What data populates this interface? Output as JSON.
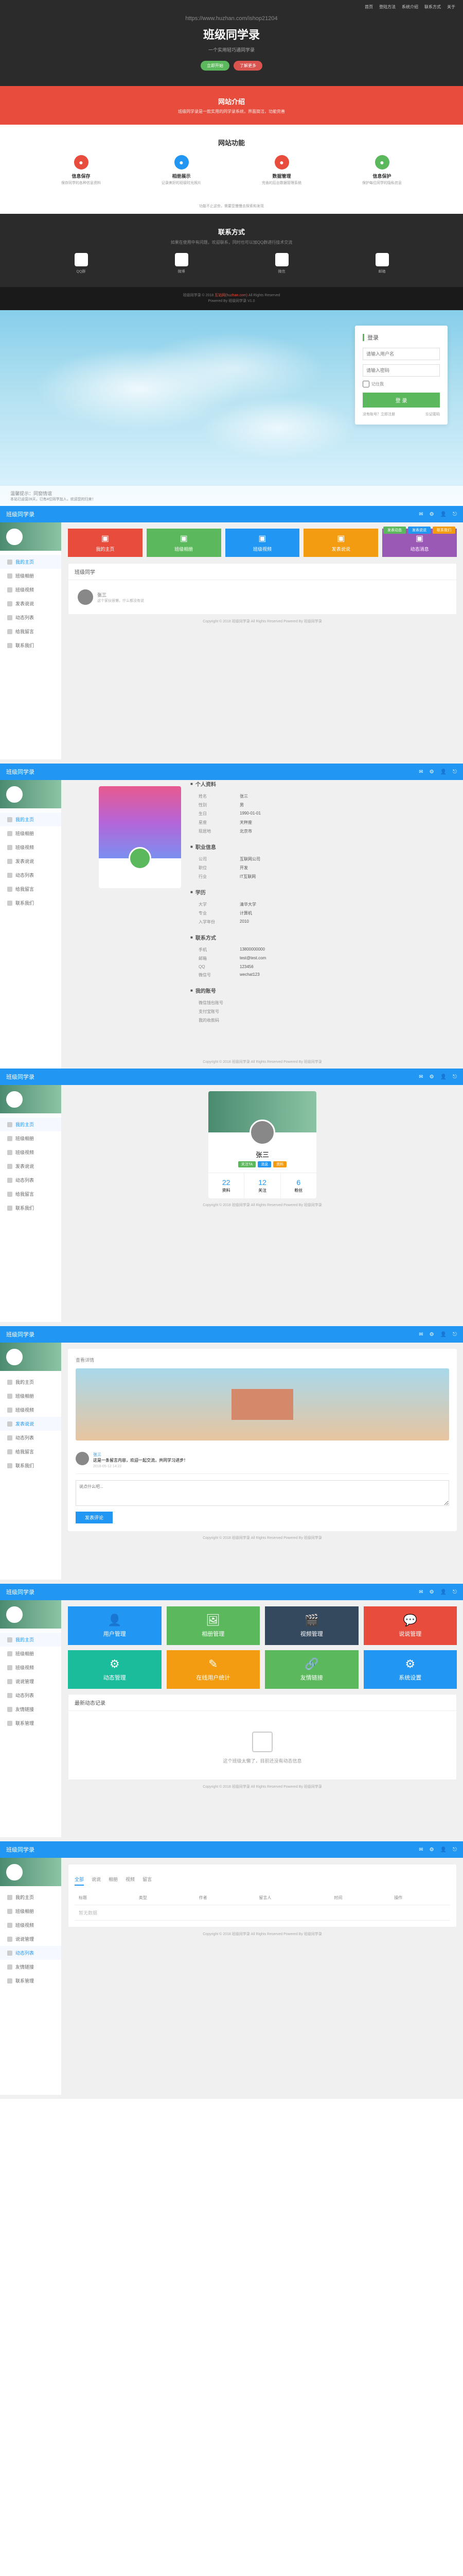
{
  "url": "https://www.huzhan.com/ishop21204",
  "landing": {
    "nav": [
      "首页",
      "登陆方法",
      "系统介绍",
      "联系方式",
      "关于"
    ],
    "title": "班级同学录",
    "subtitle": "一个实用轻巧通同学录",
    "btn1": "立即开始",
    "btn2": "了解更多",
    "intro_h": "网站介绍",
    "intro_p": "班级同学录是一款实用的同学录系统，界面简洁，功能完善",
    "func_h": "网站功能",
    "features": [
      {
        "title": "信息保存",
        "desc": "保存同学的各种信息资料",
        "color": "#e74c3c"
      },
      {
        "title": "相册展示",
        "desc": "记录美好的班级时光照片",
        "color": "#2196f3"
      },
      {
        "title": "数据管理",
        "desc": "完善的后台数据管理系统",
        "color": "#e74c3c"
      },
      {
        "title": "信息保护",
        "desc": "保护每位同学的隐私信息",
        "color": "#5cb85c"
      }
    ],
    "note": "功能不止这些，需要您慢慢去探索和发现",
    "contact_h": "联系方式",
    "contact_sub": "如果在使用中有问题，欢迎联系，同时也可以加QQ群进行技术交流",
    "contacts": [
      {
        "label": "QQ群"
      },
      {
        "label": "微博"
      },
      {
        "label": "微信"
      },
      {
        "label": "邮箱"
      }
    ],
    "footer1": "班级同学录 © 2018",
    "footer_red": "互站网(huzhan.com)",
    "footer2": "All Rights Reserved",
    "footer3": "Powered By 班级同学录 V1.0"
  },
  "login": {
    "header": "登录",
    "user_ph": "请输入用户名",
    "pass_ph": "请输入密码",
    "remember": "记住我",
    "btn": "登 录",
    "link1": "没有账号？立即注册",
    "link2": "忘记密码",
    "bottom": "温馨提示：同窗情谊",
    "bottom2": "本站已运营28天，已有4位同学加入，欢迎您的归来！"
  },
  "dash": {
    "brand": "班级同学录",
    "top_icons": [
      "✉",
      "⚙",
      "👤",
      "⎋"
    ],
    "menu": [
      "我的主页",
      "班级相册",
      "班级视频",
      "发表说说",
      "动态列表",
      "给我留言",
      "联系我们"
    ],
    "admin_menu": [
      "我的主页",
      "班级相册",
      "班级视频",
      "说说管理",
      "动态列表",
      "友情链接",
      "联系管理"
    ],
    "footer": "Copyright © 2018 班级同学录 All Rights Reserved  Powered By 班级同学录"
  },
  "s3": {
    "quick": [
      "发表动态",
      "发表说说",
      "联系我们"
    ],
    "tiles": [
      {
        "label": "我的主页",
        "color": "bg-red"
      },
      {
        "label": "班级相册",
        "color": "bg-green"
      },
      {
        "label": "班级视频",
        "color": "bg-blue"
      },
      {
        "label": "发表说说",
        "color": "bg-orange"
      },
      {
        "label": "动态消息",
        "color": "bg-purple"
      }
    ],
    "panel_h": "班级同学",
    "friend": "张三",
    "friend_sig": "这个家伙很懒，什么都没有说"
  },
  "s4": {
    "sections": [
      {
        "h": "个人资料",
        "rows": [
          [
            "姓名",
            "张三"
          ],
          [
            "性别",
            "男"
          ],
          [
            "生日",
            "1990-01-01"
          ],
          [
            "星座",
            "天秤座"
          ],
          [
            "现居地",
            "北京市"
          ]
        ]
      },
      {
        "h": "职业信息",
        "rows": [
          [
            "公司",
            "互联网公司"
          ],
          [
            "职位",
            "开发"
          ],
          [
            "行业",
            "IT互联网"
          ]
        ]
      },
      {
        "h": "学历",
        "rows": [
          [
            "大学",
            "清华大学"
          ],
          [
            "专业",
            "计算机"
          ],
          [
            "入学年份",
            "2010"
          ]
        ]
      },
      {
        "h": "联系方式",
        "rows": [
          [
            "手机",
            "13800000000"
          ],
          [
            "邮箱",
            "test@test.com"
          ],
          [
            "QQ",
            "123456"
          ],
          [
            "微信号",
            "wechat123"
          ]
        ]
      },
      {
        "h": "我的账号",
        "rows": [
          [
            "微信钱包账号",
            ""
          ],
          [
            "支付宝账号",
            ""
          ],
          [
            "我的收款码",
            ""
          ]
        ]
      }
    ]
  },
  "s5": {
    "name": "张三",
    "badges": [
      {
        "t": "关注TA",
        "c": "bg-green"
      },
      {
        "t": "消息",
        "c": "bg-blue"
      },
      {
        "t": "资料",
        "c": "bg-orange"
      }
    ],
    "stats": [
      [
        "22",
        "资料"
      ],
      [
        "12",
        "关注"
      ],
      [
        "6",
        "粉丝"
      ]
    ]
  },
  "s6": {
    "panel_h": "查看详情",
    "comment_user": "张三",
    "comment_text": "这是一条留言内容，欢迎一起交流，共同学习进步！",
    "comment_time": "2018-05-12 14:22",
    "reply_ph": "说点什么吧...",
    "submit": "发表评论"
  },
  "s7": {
    "row1": [
      {
        "label": "用户管理",
        "color": "bg-blue"
      },
      {
        "label": "相册管理",
        "color": "bg-green"
      },
      {
        "label": "视频管理",
        "color": "bg-navy"
      },
      {
        "label": "说说管理",
        "color": "bg-red"
      }
    ],
    "row2": [
      {
        "label": "动态管理",
        "color": "bg-teal"
      },
      {
        "label": "在线用户统计",
        "color": "bg-orange"
      },
      {
        "label": "友情链接",
        "color": "bg-green"
      },
      {
        "label": "系统设置",
        "color": "bg-blue"
      }
    ],
    "panel_h": "最新动态记录",
    "empty": "这个班级太懒了，目前还没有动态信息"
  },
  "s8": {
    "tabs": [
      "全部",
      "说说",
      "相册",
      "视频",
      "留言"
    ],
    "cols": [
      "标题",
      "类型",
      "作者",
      "留言人",
      "时间",
      "操作"
    ],
    "empty": "暂无数据"
  }
}
